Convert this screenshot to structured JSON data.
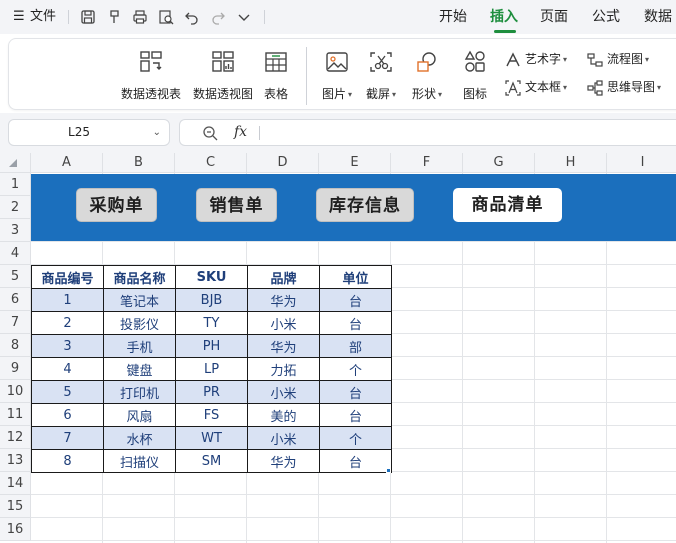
{
  "menubar": {
    "hamburger": "☰",
    "file_label": "文件",
    "tabs": [
      {
        "label": "开始",
        "active": false
      },
      {
        "label": "插入",
        "active": true
      },
      {
        "label": "页面",
        "active": false
      },
      {
        "label": "公式",
        "active": false
      },
      {
        "label": "数据",
        "active": false
      }
    ],
    "accent_color": "#1e8e3e"
  },
  "ribbon": {
    "buttons": [
      {
        "label": "数据透视表",
        "icon": "pivot-table-icon"
      },
      {
        "label": "数据透视图",
        "icon": "pivot-chart-icon"
      },
      {
        "label": "表格",
        "icon": "table-icon"
      },
      {
        "label": "图片",
        "icon": "picture-icon",
        "dropdown": true
      },
      {
        "label": "截屏",
        "icon": "screenshot-icon",
        "dropdown": true
      },
      {
        "label": "形状",
        "icon": "shapes-icon",
        "dropdown": true
      },
      {
        "label": "图标",
        "icon": "icons-icon"
      }
    ],
    "small_buttons": [
      {
        "label": "艺术字",
        "icon": "wordart-icon",
        "dropdown": true
      },
      {
        "label": "流程图",
        "icon": "flowchart-icon",
        "dropdown": true
      },
      {
        "label": "文本框",
        "icon": "textbox-icon",
        "dropdown": true
      },
      {
        "label": "思维导图",
        "icon": "mindmap-icon",
        "dropdown": true
      }
    ]
  },
  "formula_bar": {
    "name_box": "L25",
    "fx_label": "fx",
    "formula": ""
  },
  "sheet": {
    "columns": [
      "A",
      "B",
      "C",
      "D",
      "E",
      "F",
      "G",
      "H",
      "I"
    ],
    "rows": [
      "1",
      "2",
      "3",
      "4",
      "5",
      "6",
      "7",
      "8",
      "9",
      "10",
      "11",
      "12",
      "13",
      "14",
      "15",
      "16"
    ],
    "banner_color": "#1b6fbd",
    "nav_buttons": [
      {
        "label": "采购单"
      },
      {
        "label": "销售单"
      },
      {
        "label": "库存信息"
      },
      {
        "label": "商品清单"
      }
    ],
    "table": {
      "headers": [
        "商品编号",
        "商品名称",
        "SKU",
        "品牌",
        "单位"
      ],
      "rows": [
        [
          "1",
          "笔记本",
          "BJB",
          "华为",
          "台"
        ],
        [
          "2",
          "投影仪",
          "TY",
          "小米",
          "台"
        ],
        [
          "3",
          "手机",
          "PH",
          "华为",
          "部"
        ],
        [
          "4",
          "键盘",
          "LP",
          "力拓",
          "个"
        ],
        [
          "5",
          "打印机",
          "PR",
          "小米",
          "台"
        ],
        [
          "6",
          "风扇",
          "FS",
          "美的",
          "台"
        ],
        [
          "7",
          "水杯",
          "WT",
          "小米",
          "个"
        ],
        [
          "8",
          "扫描仪",
          "SM",
          "华为",
          "台"
        ]
      ],
      "stripe_color": "#d9e2f3",
      "text_color": "#1f3f7a"
    }
  }
}
